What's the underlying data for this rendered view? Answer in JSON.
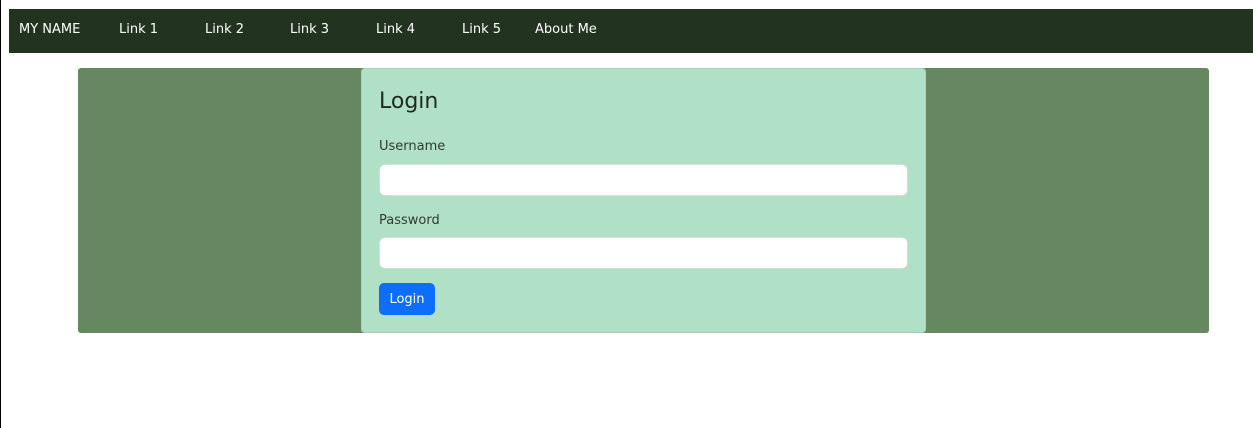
{
  "navbar": {
    "brand": "MY NAME",
    "links": [
      "Link 1",
      "Link 2",
      "Link 3",
      "Link 4",
      "Link 5",
      "About Me"
    ]
  },
  "login_card": {
    "title": "Login",
    "username_label": "Username",
    "username_value": "",
    "password_label": "Password",
    "password_value": "",
    "button_label": "Login"
  },
  "colors": {
    "navbar_bg": "#22331f",
    "hero_bg": "#668861",
    "card_bg": "#b0e0c5",
    "button_bg": "#0d6efd"
  }
}
